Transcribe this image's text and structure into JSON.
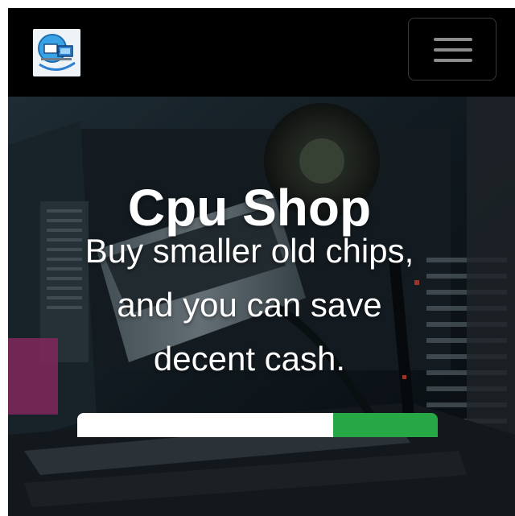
{
  "navbar": {
    "logo_icon": "computer-network-logo-icon",
    "menu_icon": "hamburger-menu-icon"
  },
  "hero": {
    "title": "Cpu Shop",
    "subtitle_lines": [
      "Buy smaller old chips,",
      "and you can save",
      "decent cash."
    ]
  },
  "search": {
    "placeholder": "",
    "button_label": ""
  },
  "colors": {
    "navbar_bg": "#000000",
    "button_green": "#28a745",
    "text_white": "#ffffff"
  }
}
